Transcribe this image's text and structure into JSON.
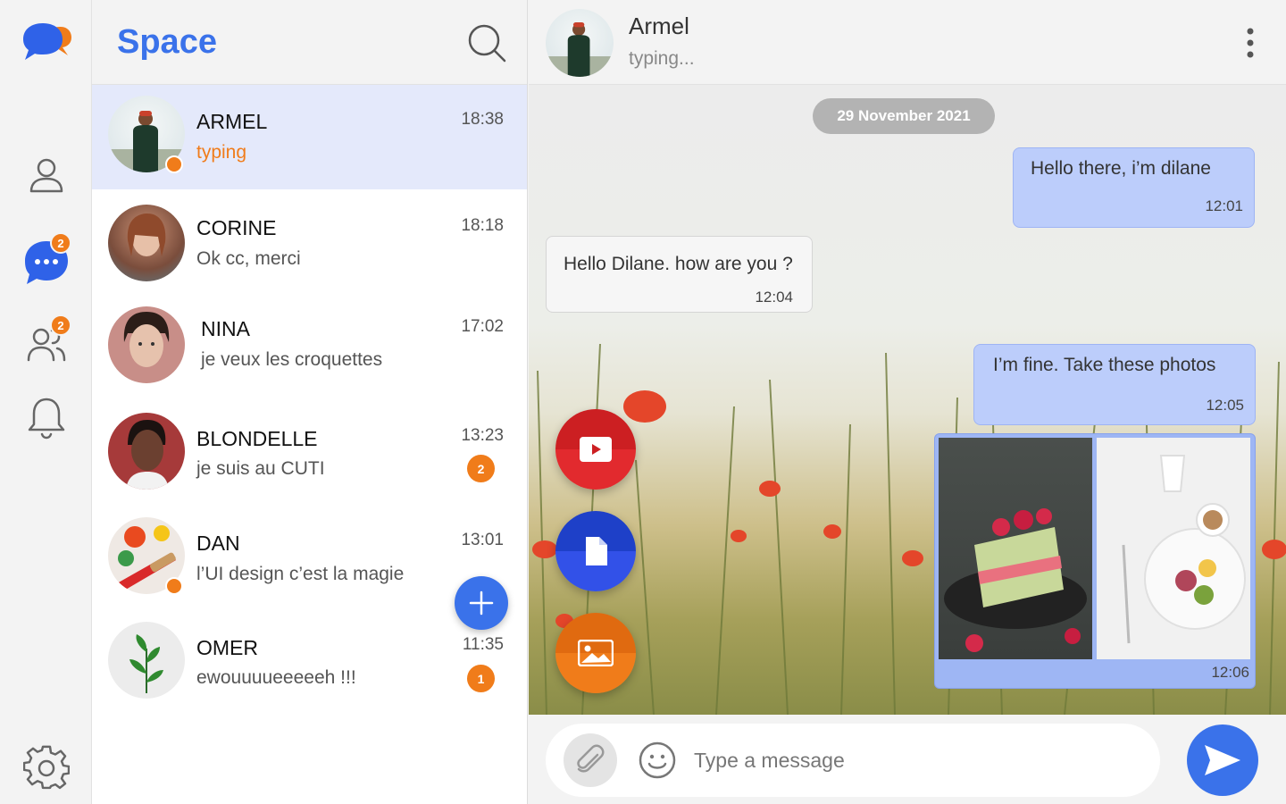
{
  "app": {
    "title": "Space"
  },
  "rail": {
    "chats_badge": "2",
    "contacts_badge": "2"
  },
  "conversations": [
    {
      "name": "ARMEL",
      "preview": "typing",
      "time": "18:38",
      "online": true,
      "active": true,
      "unread": ""
    },
    {
      "name": "CORINE",
      "preview": "Ok cc, merci",
      "time": "18:18",
      "online": false,
      "active": false,
      "unread": ""
    },
    {
      "name": "NINA",
      "preview": "je veux les croquettes",
      "time": "17:02",
      "online": false,
      "active": false,
      "unread": ""
    },
    {
      "name": "BLONDELLE",
      "preview": "je suis au CUTI",
      "time": "13:23",
      "online": false,
      "active": false,
      "unread": "2"
    },
    {
      "name": "DAN",
      "preview": "l’UI design c’est la magie",
      "time": "13:01",
      "online": true,
      "active": false,
      "unread": ""
    },
    {
      "name": "OMER",
      "preview": "ewouuuueeeeeh !!!",
      "time": "11:35",
      "online": false,
      "active": false,
      "unread": "1"
    }
  ],
  "chat": {
    "contact_name": "Armel",
    "contact_status": "typing...",
    "date_separator": "29 November 2021",
    "messages": [
      {
        "direction": "out",
        "text": "Hello  there, i’m dilane",
        "time": "12:01"
      },
      {
        "direction": "in",
        "text": "Hello Dilane. how are you ?",
        "time": "12:04"
      },
      {
        "direction": "out",
        "text": "I’m fine. Take these photos",
        "time": "12:05"
      },
      {
        "direction": "out",
        "type": "photos",
        "time": "12:06"
      }
    ]
  },
  "composer": {
    "placeholder": "Type a message"
  },
  "colors": {
    "accent": "#3a72ea",
    "orange": "#f07c1a",
    "active_row": "#e4e9fb",
    "outgoing_bubble": "#bccdfb"
  },
  "icons": [
    "app-logo-icon",
    "profile-icon",
    "chat-icon",
    "group-icon",
    "bell-icon",
    "settings-icon",
    "search-icon",
    "more-vertical-icon",
    "youtube-icon",
    "document-icon",
    "image-icon",
    "paperclip-icon",
    "emoji-icon",
    "send-icon",
    "plus-icon"
  ]
}
